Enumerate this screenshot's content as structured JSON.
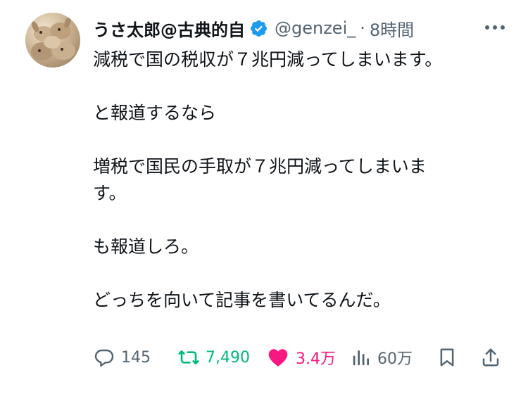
{
  "user": {
    "display_name": "うさ太郎@古典的自",
    "handle": "@genzei_",
    "separator": "·",
    "time": "8時間",
    "verified": true,
    "avatar_icon": "rabbit-avatar",
    "verified_color": "#1d9bf0"
  },
  "tweet": {
    "paragraphs": [
      "減税で国の税収が７兆円減ってしまいます。",
      "と報道するなら",
      "増税で国民の手取が７兆円減ってしまいま\nす。",
      "も報道しろ。",
      "どっちを向いて記事を書いてるんだ。"
    ]
  },
  "actions": {
    "reply": {
      "icon": "reply-icon",
      "count": "145"
    },
    "retweet": {
      "icon": "retweet-icon",
      "count": "7,490",
      "color": "#00ba7c"
    },
    "like": {
      "icon": "heart-icon",
      "count": "3.4万",
      "color": "#f91880",
      "liked": true
    },
    "views": {
      "icon": "views-icon",
      "count": "60万"
    },
    "bookmark": {
      "icon": "bookmark-icon"
    },
    "share": {
      "icon": "share-icon"
    }
  },
  "colors": {
    "text": "#0f1419",
    "muted": "#536471",
    "background": "#ffffff"
  }
}
